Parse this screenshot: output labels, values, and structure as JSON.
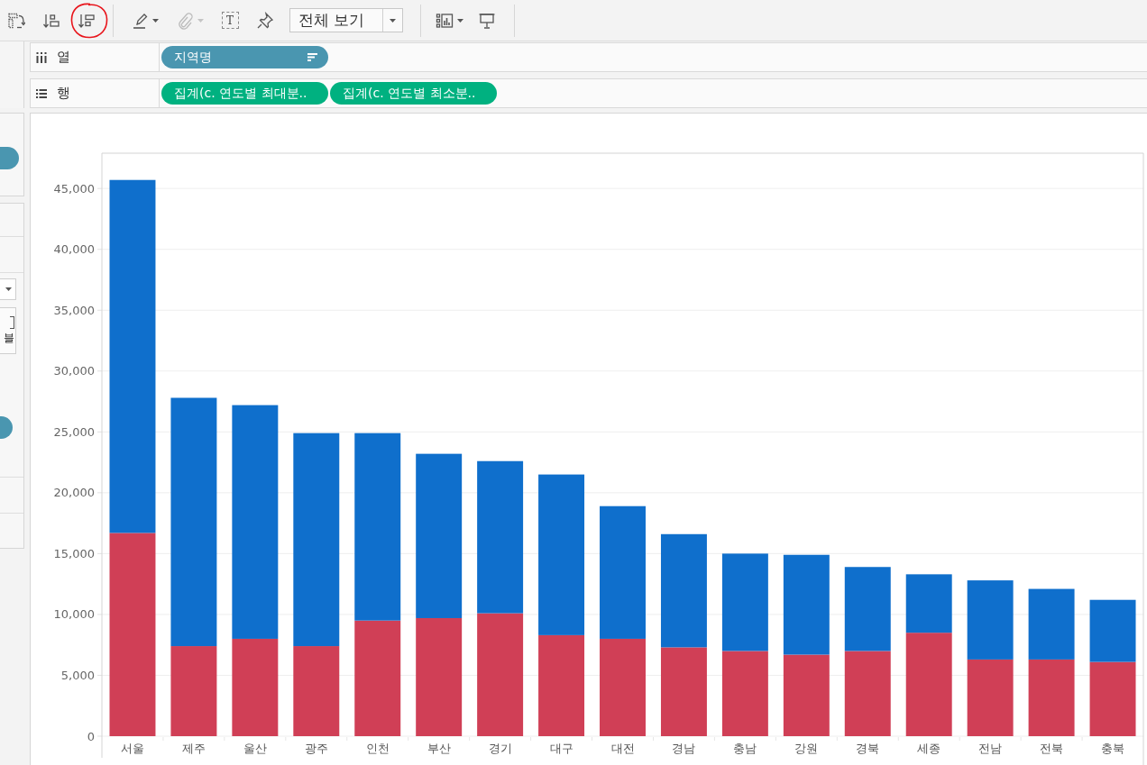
{
  "toolbar": {
    "groups": [
      {
        "items": [
          {
            "kind": "button",
            "disabled": false,
            "menu": false,
            "circled": false
          },
          {
            "kind": "button",
            "disabled": false,
            "menu": false,
            "circled": false
          },
          {
            "kind": "button",
            "disabled": false,
            "menu": false,
            "circled": true
          }
        ]
      },
      {
        "items": [
          {
            "kind": "button",
            "disabled": false,
            "menu": true,
            "circled": false
          },
          {
            "kind": "button",
            "disabled": true,
            "menu": true,
            "circled": false
          },
          {
            "kind": "button",
            "glyph": "T",
            "disabled": false,
            "menu": false,
            "circled": false
          },
          {
            "kind": "button",
            "disabled": false,
            "menu": false,
            "circled": false
          },
          {
            "kind": "select",
            "value": "전체 보기"
          }
        ]
      },
      {
        "items": [
          {
            "kind": "button",
            "disabled": false,
            "menu": true,
            "circled": false
          },
          {
            "kind": "button",
            "disabled": false,
            "menu": false,
            "circled": false
          }
        ]
      }
    ]
  },
  "side_panel": {
    "card_text": "블"
  },
  "shelves": [
    {
      "kind": "columns",
      "label": "열",
      "pills": [
        {
          "kind": "dimension",
          "text": "지역명",
          "sorted": true
        }
      ]
    },
    {
      "kind": "rows",
      "label": "행",
      "pills": [
        {
          "kind": "measure",
          "text": "집계(c. 연도별 최대분..",
          "sorted": false
        },
        {
          "kind": "measure",
          "text": "집계(c. 연도별 최소분..",
          "sorted": false
        }
      ]
    }
  ],
  "chart": {
    "chart_data": {
      "type": "bar",
      "stacked": true,
      "grid": true,
      "categories": [
        "서울",
        "제주",
        "울산",
        "광주",
        "인천",
        "부산",
        "경기",
        "대구",
        "대전",
        "경남",
        "충남",
        "강원",
        "경북",
        "세종",
        "전남",
        "전북",
        "충북"
      ],
      "series": [
        {
          "color": "#d03f56",
          "values": [
            16700,
            7400,
            8000,
            7400,
            9500,
            9700,
            10100,
            8300,
            8000,
            7300,
            7000,
            6700,
            7000,
            8500,
            6300,
            6300,
            6100
          ]
        },
        {
          "color": "#0f6fcc",
          "values": [
            29000,
            20400,
            19200,
            17500,
            15400,
            13500,
            12500,
            13200,
            10900,
            9300,
            8000,
            8200,
            6900,
            4800,
            6500,
            5800,
            5100
          ]
        }
      ],
      "ylim": [
        0,
        47900
      ],
      "yticks": [
        {
          "value": 0,
          "label": "0"
        },
        {
          "value": 5000,
          "label": "5,000"
        },
        {
          "value": 10000,
          "label": "10,000"
        },
        {
          "value": 15000,
          "label": "15,000"
        },
        {
          "value": 20000,
          "label": "20,000"
        },
        {
          "value": 25000,
          "label": "25,000"
        },
        {
          "value": 30000,
          "label": "30,000"
        },
        {
          "value": 35000,
          "label": "35,000"
        },
        {
          "value": 40000,
          "label": "40,000"
        },
        {
          "value": 45000,
          "label": "45,000"
        }
      ]
    }
  }
}
